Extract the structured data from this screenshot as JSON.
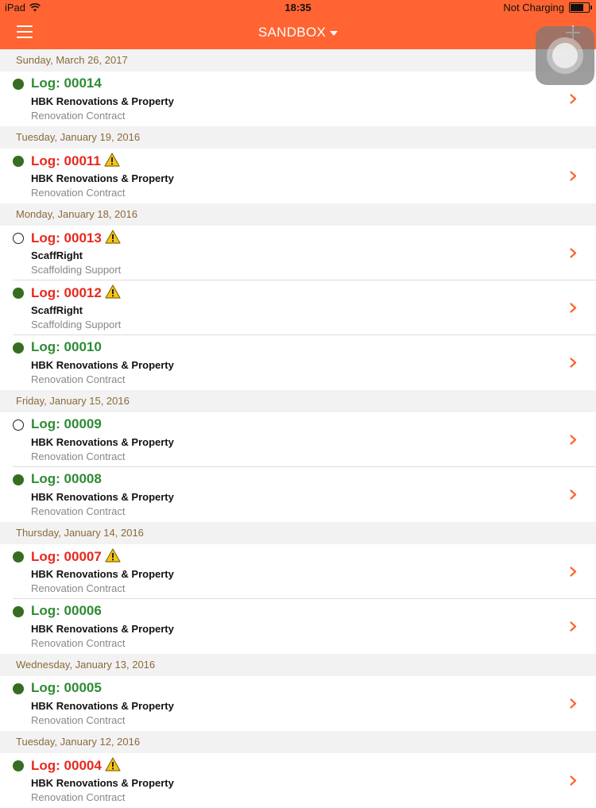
{
  "status_bar": {
    "device": "iPad",
    "time": "18:35",
    "charging": "Not Charging"
  },
  "nav": {
    "title": "SANDBOX"
  },
  "sections": [
    {
      "date": "Sunday, March 26, 2017",
      "rows": [
        {
          "log": "Log: 00014",
          "color": "green",
          "status": "filled",
          "warning": false,
          "company": "HBK Renovations & Property",
          "contract": "Renovation Contract"
        }
      ]
    },
    {
      "date": "Tuesday, January 19, 2016",
      "rows": [
        {
          "log": "Log: 00011",
          "color": "red",
          "status": "filled",
          "warning": true,
          "company": "HBK Renovations & Property",
          "contract": "Renovation Contract"
        }
      ]
    },
    {
      "date": "Monday, January 18, 2016",
      "rows": [
        {
          "log": "Log: 00013",
          "color": "red",
          "status": "open",
          "warning": true,
          "company": "ScaffRight",
          "contract": "Scaffolding Support"
        },
        {
          "log": "Log: 00012",
          "color": "red",
          "status": "filled",
          "warning": true,
          "company": "ScaffRight",
          "contract": "Scaffolding Support"
        },
        {
          "log": "Log: 00010",
          "color": "green",
          "status": "filled",
          "warning": false,
          "company": "HBK Renovations & Property",
          "contract": "Renovation Contract"
        }
      ]
    },
    {
      "date": "Friday, January 15, 2016",
      "rows": [
        {
          "log": "Log: 00009",
          "color": "green",
          "status": "open",
          "warning": false,
          "company": "HBK Renovations & Property",
          "contract": "Renovation Contract"
        },
        {
          "log": "Log: 00008",
          "color": "green",
          "status": "filled",
          "warning": false,
          "company": "HBK Renovations & Property",
          "contract": "Renovation Contract"
        }
      ]
    },
    {
      "date": "Thursday, January 14, 2016",
      "rows": [
        {
          "log": "Log: 00007",
          "color": "red",
          "status": "filled",
          "warning": true,
          "company": "HBK Renovations & Property",
          "contract": "Renovation Contract"
        },
        {
          "log": "Log: 00006",
          "color": "green",
          "status": "filled",
          "warning": false,
          "company": "HBK Renovations & Property",
          "contract": "Renovation Contract"
        }
      ]
    },
    {
      "date": "Wednesday, January 13, 2016",
      "rows": [
        {
          "log": "Log: 00005",
          "color": "green",
          "status": "filled",
          "warning": false,
          "company": "HBK Renovations & Property",
          "contract": "Renovation Contract"
        }
      ]
    },
    {
      "date": "Tuesday, January 12, 2016",
      "rows": [
        {
          "log": "Log: 00004",
          "color": "red",
          "status": "filled",
          "warning": true,
          "company": "HBK Renovations & Property",
          "contract": "Renovation Contract"
        }
      ]
    }
  ],
  "colors": {
    "accent": "#ff6432",
    "green": "#2e8b35",
    "red": "#e8281e",
    "dot": "#356e21",
    "section_text": "#8a6a3a"
  },
  "icons": {
    "menu": "hamburger-icon",
    "add": "plus-icon",
    "dropdown": "caret-down-icon",
    "row": "chevron-right-icon",
    "warning": "warning-icon"
  }
}
